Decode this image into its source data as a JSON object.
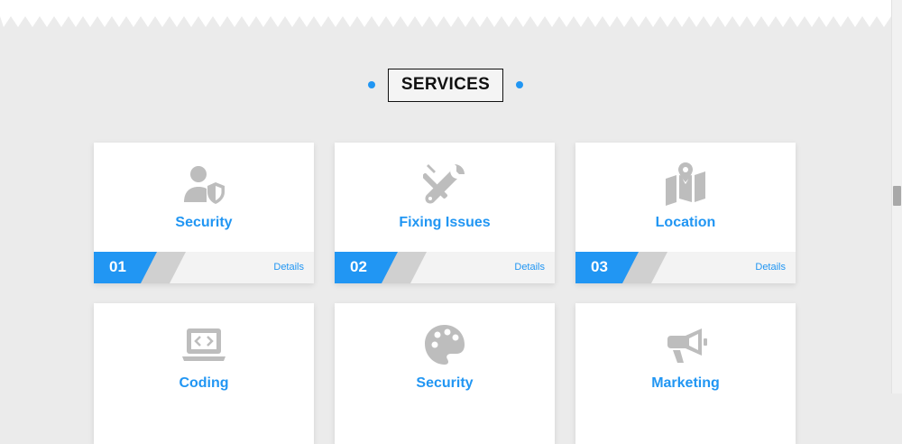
{
  "section": {
    "heading": "SERVICES"
  },
  "colors": {
    "accent": "#2196f3",
    "icon": "#bdbdbd",
    "background": "#ebebeb"
  },
  "cards": [
    {
      "title": "Security",
      "number": "01",
      "details": "Details",
      "icon": "user-shield-icon"
    },
    {
      "title": "Fixing Issues",
      "number": "02",
      "details": "Details",
      "icon": "tools-icon"
    },
    {
      "title": "Location",
      "number": "03",
      "details": "Details",
      "icon": "map-marker-icon"
    },
    {
      "title": "Coding",
      "icon": "laptop-code-icon"
    },
    {
      "title": "Security",
      "icon": "palette-icon"
    },
    {
      "title": "Marketing",
      "icon": "megaphone-icon"
    }
  ]
}
